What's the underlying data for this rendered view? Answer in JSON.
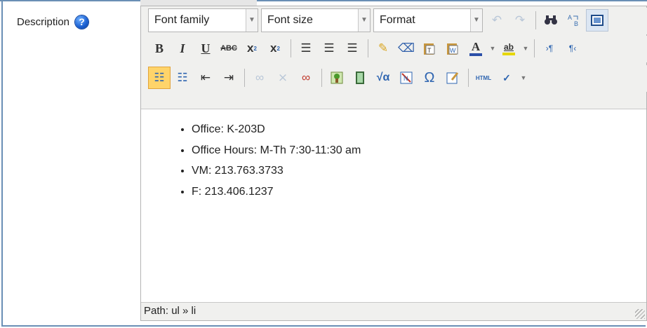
{
  "field": {
    "label": "Description",
    "help_icon": "help-icon"
  },
  "toolbar": {
    "font_family": "Font family",
    "font_size": "Font size",
    "format": "Format",
    "row1_icons": [
      "undo-icon",
      "redo-icon",
      "find-icon",
      "replace-icon",
      "fullscreen-icon"
    ],
    "row2_icons": [
      "bold-icon",
      "italic-icon",
      "underline-icon",
      "strikethrough-icon",
      "subscript-icon",
      "superscript-icon",
      "align-left-icon",
      "align-center-icon",
      "align-right-icon",
      "cleanup-icon",
      "eraser-icon",
      "paste-text-icon",
      "paste-word-icon",
      "text-color-icon",
      "highlight-color-icon",
      "ltr-icon",
      "rtl-icon"
    ],
    "row3_icons": [
      "bulleted-list-icon",
      "numbered-list-icon",
      "outdent-icon",
      "indent-icon",
      "link-icon",
      "unlink-icon",
      "anchor-icon",
      "image-icon",
      "media-icon",
      "equation-icon",
      "nolink-icon",
      "special-char-icon",
      "edit-icon",
      "html-icon",
      "spellcheck-icon"
    ],
    "bold_glyph": "B",
    "italic_glyph": "I",
    "underline_glyph": "U",
    "strike_glyph": "ABC",
    "sub_glyph": "x",
    "sup_glyph": "x",
    "omega_glyph": "Ω",
    "html_glyph": "HTML",
    "textcolor_glyph": "A",
    "highlight_glyph": "ab"
  },
  "content": {
    "items": [
      "Office: K-203D",
      "Office Hours: M-Th 7:30-11:30 am",
      "VM: 213.763.3733",
      "F: 213.406.1237"
    ]
  },
  "status": {
    "path": "Path: ul » li"
  },
  "colors": {
    "frame_border": "#6a8fb5",
    "toolbar_bg": "#f0f0ee",
    "active_button": "#ffd46a"
  }
}
